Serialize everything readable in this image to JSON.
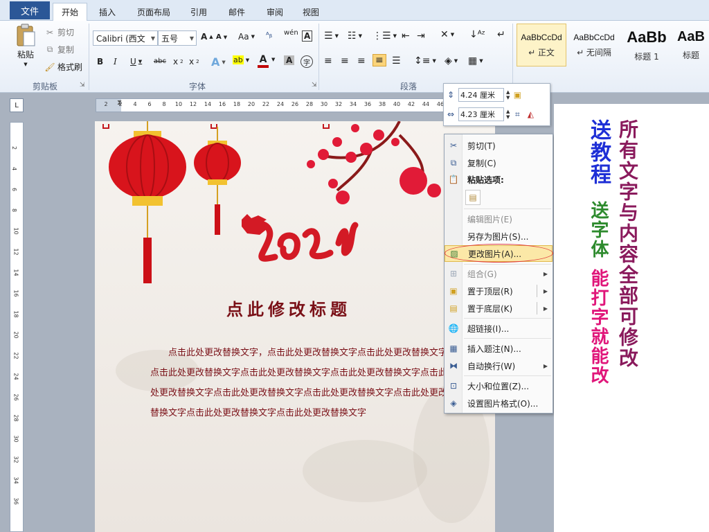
{
  "tabs": {
    "file": "文件",
    "items": [
      {
        "label": "开始"
      },
      {
        "label": "插入"
      },
      {
        "label": "页面布局"
      },
      {
        "label": "引用"
      },
      {
        "label": "邮件"
      },
      {
        "label": "审阅"
      },
      {
        "label": "视图"
      }
    ]
  },
  "ribbon": {
    "clipboard": {
      "paste": "粘贴",
      "cut": "剪切",
      "copy": "复制",
      "format_painter": "格式刷",
      "group": "剪贴板"
    },
    "font": {
      "name": "Calibri (西文",
      "size": "五号",
      "group": "字体",
      "font_color": "#c00000"
    },
    "paragraph": {
      "group": "段落"
    },
    "styles": [
      {
        "preview": "AaBbCcDd",
        "name": "↵ 正文"
      },
      {
        "preview": "AaBbCcDd",
        "name": "↵ 无间隔"
      },
      {
        "preview": "AaBb",
        "name": "标题 1"
      },
      {
        "preview": "AaB",
        "name": "标题"
      }
    ]
  },
  "ruler": {
    "corner": "L",
    "h_ticks": [
      "2",
      "2",
      "4",
      "6",
      "8",
      "10",
      "12",
      "14",
      "16",
      "18",
      "20",
      "22",
      "24",
      "26",
      "28",
      "30",
      "32",
      "34",
      "36",
      "38",
      "40",
      "42",
      "44",
      "46"
    ],
    "v_ticks": [
      "2",
      "4",
      "6",
      "8",
      "10",
      "12",
      "14",
      "16",
      "18",
      "20",
      "22",
      "24",
      "26",
      "28",
      "30",
      "32",
      "34",
      "36"
    ]
  },
  "document": {
    "title": "点此修改标题",
    "body": "点击此处更改替换文字，点击此处更改替换文字点击此处更改替换文字点击此处更改替换文字点击此处更改替换文字点击此处更改替换文字点击此处更改替换文字点击此处更改替换文字点击此处更改替换文字点击此处更改替换文字点击此处更改替换文字点击此处更改替换文字",
    "title_color": "#7a1017"
  },
  "mini_toolbar": {
    "height": "4.24 厘米",
    "width": "4.23 厘米"
  },
  "context_menu": {
    "items": [
      {
        "label": "剪切(T)",
        "icon": "scissors-icon"
      },
      {
        "label": "复制(C)",
        "icon": "copy-icon"
      },
      {
        "label": "粘贴选项:",
        "icon": "paste-icon"
      },
      {
        "label": "编辑图片(E)",
        "icon": ""
      },
      {
        "label": "另存为图片(S)...",
        "icon": ""
      },
      {
        "label": "更改图片(A)...",
        "icon": "change-picture-icon"
      },
      {
        "label": "组合(G)",
        "icon": "group-icon"
      },
      {
        "label": "置于顶层(R)",
        "icon": "bring-front-icon"
      },
      {
        "label": "置于底层(K)",
        "icon": "send-back-icon"
      },
      {
        "label": "超链接(I)...",
        "icon": "hyperlink-icon"
      },
      {
        "label": "插入题注(N)...",
        "icon": "caption-icon"
      },
      {
        "label": "自动换行(W)",
        "icon": "wrap-icon"
      },
      {
        "label": "大小和位置(Z)...",
        "icon": "size-icon"
      },
      {
        "label": "设置图片格式(O)...",
        "icon": "format-picture-icon"
      }
    ]
  },
  "promo": {
    "line_blue": "送教程",
    "line_green": "送字体",
    "line_pink": "能打字就能改",
    "line_purple": "所有文字与内容全部可修改",
    "colors": {
      "blue": "#1e2fd6",
      "green": "#2e8b2e",
      "pink": "#e0167a",
      "purple": "#8a1a5c"
    }
  }
}
